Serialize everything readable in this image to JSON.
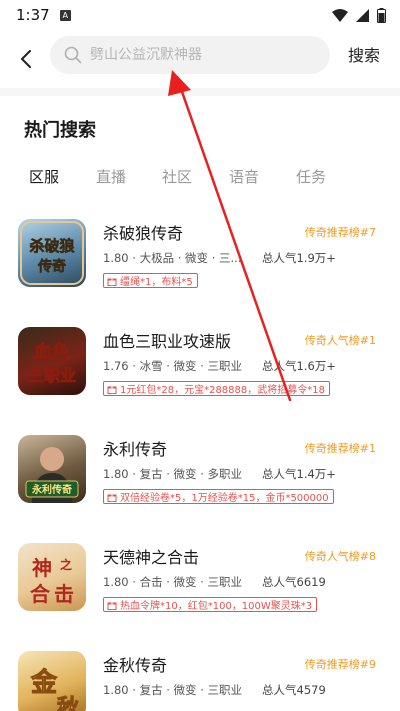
{
  "status": {
    "time": "1:37",
    "a_icon": "A"
  },
  "header": {
    "search_placeholder": "劈山公益沉默神器",
    "search_label": "搜索"
  },
  "section_title": "热门搜索",
  "tabs": [
    "区服",
    "直播",
    "社区",
    "语音",
    "任务"
  ],
  "games": [
    {
      "name": "杀破狼传奇",
      "rank": "传奇推荐榜#7",
      "meta": "1.80 · 大极品 · 微变 · 三...",
      "popularity": "总人气1.9万+",
      "gift": "缰绳*1，布料*5",
      "icon_text": "杀破狼传奇"
    },
    {
      "name": "血色三职业攻速版",
      "rank": "传奇人气榜#1",
      "meta": "1.76 · 冰雪 · 微变 · 三职业",
      "popularity": "总人气1.6万+",
      "gift": "1元红包*28，元宝*288888，武将招募令*18",
      "icon_text": "血色三职业"
    },
    {
      "name": "永利传奇",
      "rank": "传奇推荐榜#1",
      "meta": "1.80 · 复古 · 微变 · 多职业",
      "popularity": "总人气1.4万+",
      "gift": "双倍经验卷*5，1万经验卷*15，金币*500000",
      "icon_text": "永利传奇"
    },
    {
      "name": "天德神之合击",
      "rank": "传奇人气榜#8",
      "meta": "1.80 · 合击 · 微变 · 三职业",
      "popularity": "总人气6619",
      "gift": "热血令牌*10，红包*100，100W聚灵珠*3",
      "icon_text": "神之合击"
    },
    {
      "name": "金秋传奇",
      "rank": "传奇推荐榜#9",
      "meta": "1.80 · 复古 · 微变 · 三职业",
      "popularity": "总人气4579",
      "gift": "",
      "icon_text": "金秋"
    }
  ],
  "colors": {
    "accent_orange": "#f29a24",
    "gift_red": "#e8534f",
    "annotation_arrow": "#e8211f"
  }
}
